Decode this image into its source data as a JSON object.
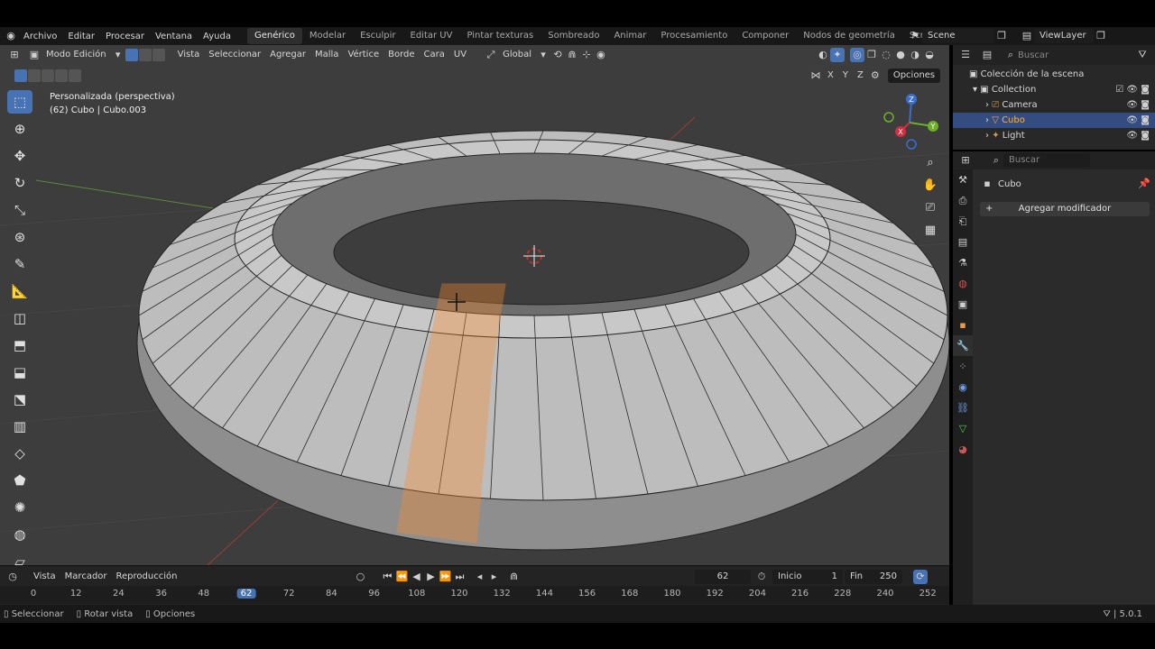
{
  "menubar": {
    "items": [
      "Archivo",
      "Editar",
      "Procesar",
      "Ventana",
      "Ayuda"
    ],
    "workspaces": [
      "Genérico",
      "Modelar",
      "Esculpir",
      "Editar UV",
      "Pintar texturas",
      "Sombreado",
      "Animar",
      "Procesamiento",
      "Componer",
      "Nodos de geometría",
      "Scripts"
    ],
    "active_workspace": "Genérico",
    "add_tab": "+",
    "scene": "Scene",
    "view_layer": "ViewLayer"
  },
  "viewport": {
    "mode": "Modo Edición",
    "menus": [
      "Vista",
      "Seleccionar",
      "Agregar",
      "Malla",
      "Vértice",
      "Borde",
      "Cara",
      "UV"
    ],
    "orientation": "Global",
    "options": "Opciones",
    "axes": [
      "X",
      "Y",
      "Z"
    ],
    "info_line1": "Personalizada (perspectiva)",
    "info_line2": "(62) Cubo | Cubo.003",
    "gizmo_labels": [
      "X",
      "Y",
      "Z"
    ],
    "accent": "#4772b3",
    "selection_color": "#ff8c2a"
  },
  "timeline": {
    "menus": [
      "Vista",
      "Marcador",
      "Reproducción"
    ],
    "current_frame": "62",
    "start_label": "Inicio",
    "start": "1",
    "end_label": "Fin",
    "end": "250",
    "ticks": [
      "0",
      "12",
      "24",
      "36",
      "48",
      "62",
      "72",
      "84",
      "96",
      "108",
      "120",
      "132",
      "144",
      "156",
      "168",
      "180",
      "192",
      "204",
      "216",
      "228",
      "240",
      "252"
    ]
  },
  "statusbar": {
    "items": [
      "Seleccionar",
      "Rotar vista",
      "Opciones"
    ],
    "version": "5.0.1"
  },
  "outliner": {
    "search_placeholder": "Buscar",
    "root": "Colección de la escena",
    "collection": "Collection",
    "items": [
      "Camera",
      "Cubo",
      "Light"
    ],
    "selected_item": "Cubo"
  },
  "properties": {
    "search_placeholder": "Buscar",
    "object_name": "Cubo",
    "add_modifier": "Agregar modificador"
  }
}
